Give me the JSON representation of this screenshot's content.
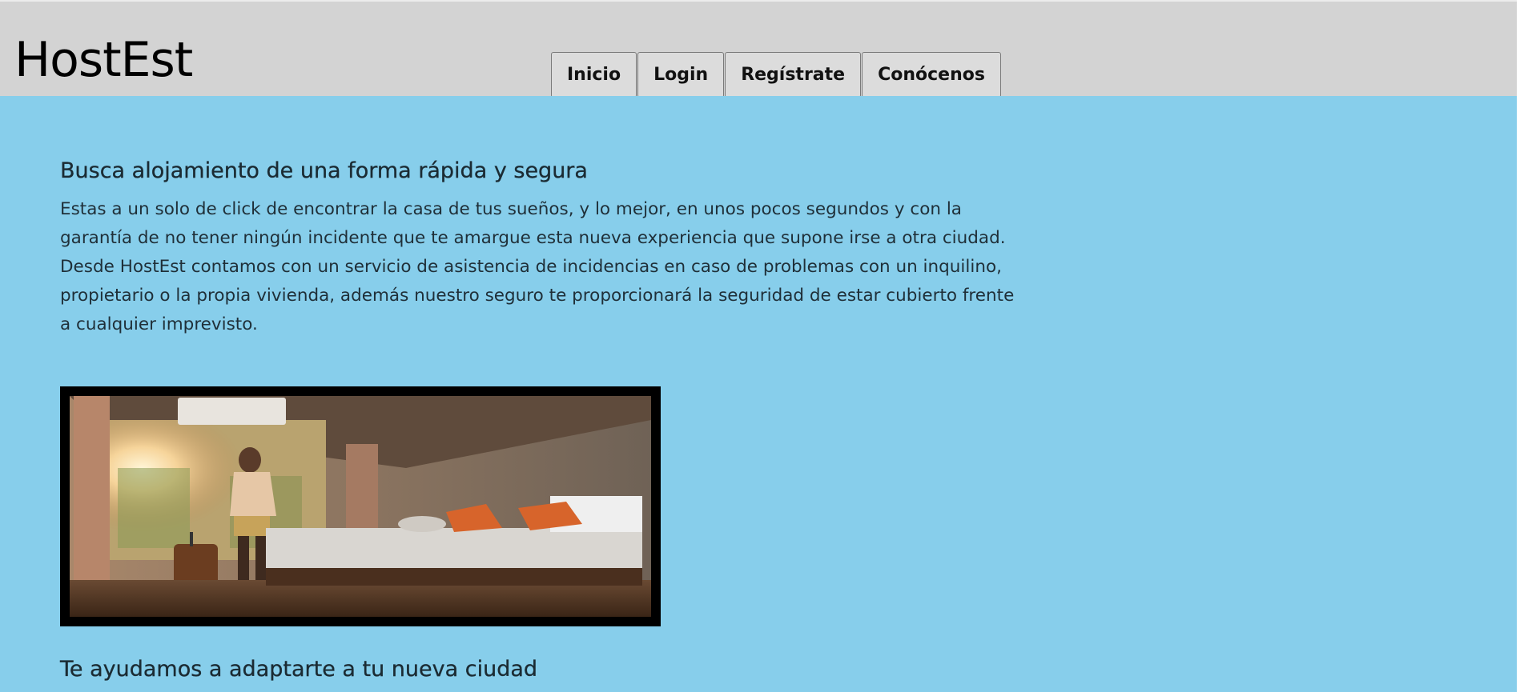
{
  "header": {
    "logo": "HostEst",
    "nav": [
      {
        "label": "Inicio"
      },
      {
        "label": "Login"
      },
      {
        "label": "Regístrate"
      },
      {
        "label": "Conócenos"
      }
    ]
  },
  "main": {
    "section1": {
      "title": "Busca alojamiento de una forma rápida y segura",
      "text": "Estas a un solo de click de encontrar la casa de tus sueños, y lo mejor, en unos pocos segundos y con la garantía de no tener ningún incidente que te amargue esta nueva experiencia que supone irse a otra ciudad. Desde HostEst contamos con un servicio de asistencia de incidencias en caso de problemas con un inquilino, propietario o la propia vivienda, además nuestro seguro te proporcionará la seguridad de estar cubierto frente a cualquier imprevisto."
    },
    "hero_image": {
      "icon": "hotel-room-photo"
    },
    "section2": {
      "title": "Te ayudamos a adaptarte a tu nueva ciudad"
    }
  },
  "colors": {
    "header_bg": "#d3d3d3",
    "main_bg": "#87ceeb",
    "image_frame": "#000000"
  }
}
